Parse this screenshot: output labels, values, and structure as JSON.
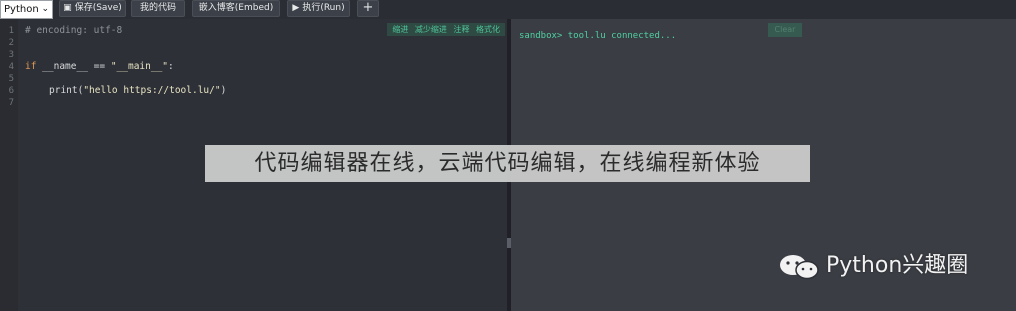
{
  "toolbar": {
    "language": "Python",
    "save_label": "保存(Save)",
    "my_code_label": "我的代码",
    "embed_label": "嵌入博客(Embed)",
    "run_label": "执行(Run)",
    "add_label": "+"
  },
  "icons": {
    "language_dropdown": "chevron-down-icon",
    "save": "floppy-disk-icon",
    "run": "play-icon",
    "add": "plus-icon"
  },
  "editor": {
    "line_numbers": [
      "1",
      "2",
      "3",
      "4",
      "5",
      "6",
      "7"
    ],
    "lines": {
      "l1": "# encoding: utf-8",
      "l4_kw": "if",
      "l4_rest": " __name__ == ",
      "l4_str": "\"__main__\"",
      "l4_end": ":",
      "l6_fn": "print(",
      "l6_str": "\"hello https://tool.lu/\"",
      "l6_end": ")"
    },
    "tools": {
      "indent": "缩进",
      "outdent": "减少缩进",
      "comment": "注释",
      "format": "格式化"
    }
  },
  "console": {
    "output": "sandbox> tool.lu connected...",
    "clear_label": "Clear"
  },
  "overlay": {
    "slogan": "代码编辑器在线，云端代码编辑，在线编程新体验"
  },
  "watermark": {
    "text": "Python兴趣圈"
  },
  "colors": {
    "background": "#2b2e34",
    "editor_bg": "#2d3036",
    "console_bg": "#3a3d43",
    "accent_green": "#4fd1a1",
    "keyword": "#e39a58",
    "comment": "#8d9399"
  }
}
